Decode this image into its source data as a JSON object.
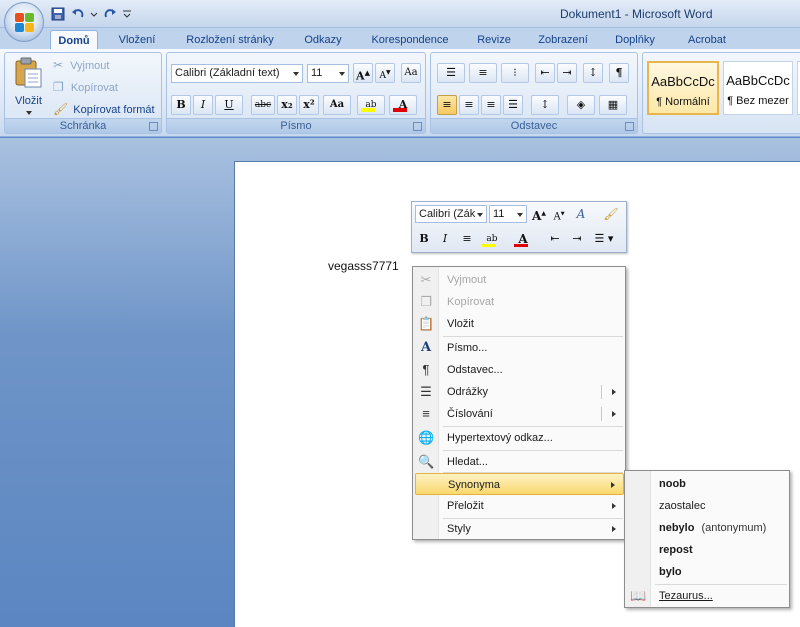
{
  "window": {
    "title": "Dokument1 - Microsoft Word"
  },
  "tabs": [
    "Domů",
    "Vložení",
    "Rozložení stránky",
    "Odkazy",
    "Korespondence",
    "Revize",
    "Zobrazení",
    "Doplňky",
    "Acrobat"
  ],
  "active_tab": "Domů",
  "clipboard": {
    "paste_label": "Vložit",
    "cut_label": "Vyjmout",
    "copy_label": "Kopírovat",
    "format_painter_label": "Kopírovat formát",
    "group_label": "Schránka"
  },
  "font": {
    "font_name": "Calibri (Základní text)",
    "font_size": "11",
    "group_label": "Písmo",
    "bold": "B",
    "italic": "I",
    "underline": "U",
    "strike": "abc",
    "subscript": "x₂",
    "superscript": "x²",
    "change_case": "Aa"
  },
  "paragraph": {
    "group_label": "Odstavec"
  },
  "styles": {
    "sample": "AaBbCcDc",
    "items": [
      "¶ Normální",
      "¶ Bez mezer"
    ]
  },
  "document": {
    "text": "vegasss7771"
  },
  "mini_toolbar": {
    "font_name": "Calibri (Zák",
    "font_size": "11"
  },
  "context_menu": {
    "items": [
      {
        "label": "Vyjmout",
        "icon": "scissors-icon",
        "disabled": true
      },
      {
        "label": "Kopírovat",
        "icon": "copy-icon",
        "disabled": true
      },
      {
        "label": "Vložit",
        "icon": "paste-icon"
      },
      {
        "label": "Písmo...",
        "icon": "font-icon"
      },
      {
        "label": "Odstavec...",
        "icon": "paragraph-icon"
      },
      {
        "label": "Odrážky",
        "icon": "bullets-icon",
        "submenu": true
      },
      {
        "label": "Číslování",
        "icon": "numbering-icon",
        "submenu": true
      },
      {
        "label": "Hypertextový odkaz...",
        "icon": "hyperlink-icon"
      },
      {
        "label": "Hledat...",
        "icon": "search-icon"
      },
      {
        "label": "Synonyma",
        "submenu": true,
        "highlighted": true
      },
      {
        "label": "Přeložit",
        "submenu": true
      },
      {
        "label": "Styly",
        "submenu": true
      }
    ]
  },
  "synonyms_menu": {
    "items": [
      "noob",
      "zaostalec",
      "nebylo",
      "repost",
      "bylo"
    ],
    "antonym_note": "(antonymum)",
    "thesaurus_label": "Tezaurus..."
  },
  "colors": {
    "accent_highlight": "#f9d86d",
    "ribbon_text": "#15428b",
    "font_color_bar": "#e00000",
    "highlight_bar": "#ffff00"
  }
}
